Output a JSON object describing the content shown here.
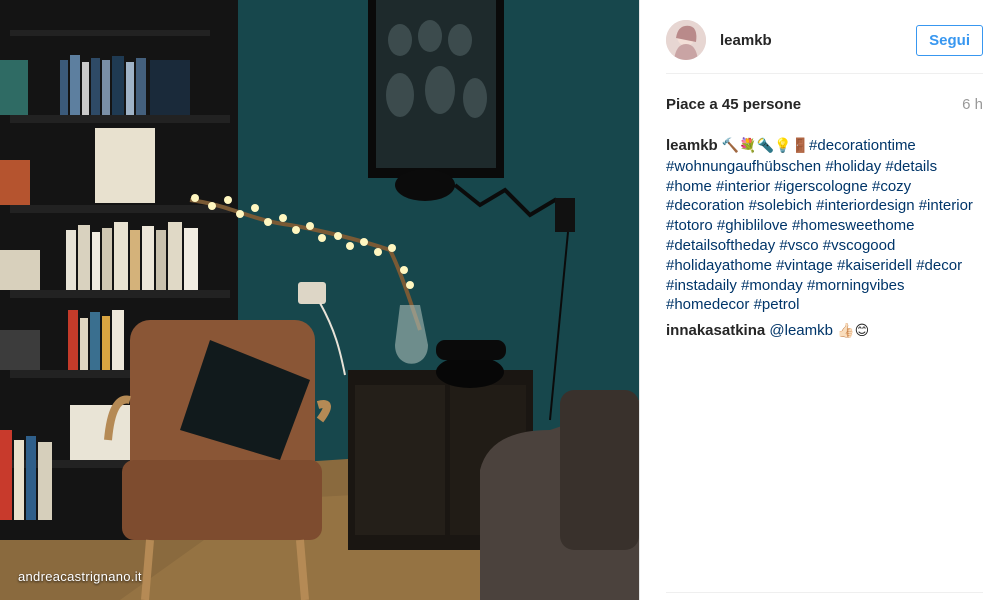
{
  "watermark": "andreacastrignano.it",
  "post": {
    "author": "leamkb",
    "follow_label": "Segui",
    "likes": "Piace a 45 persone",
    "time": "6 h"
  },
  "caption": {
    "user": "leamkb",
    "emojis": "🔨💐🔦💡🚪",
    "tags": [
      "#decorationtime",
      "#wohnungaufhübschen",
      "#holiday",
      "#details",
      "#home",
      "#interior",
      "#igerscologne",
      "#cozy",
      "#decoration",
      "#solebich",
      "#interiordesign",
      "#interior",
      "#totoro",
      "#ghiblilove",
      "#homesweethome",
      "#detailsoftheday",
      "#vsco",
      "#vscogood",
      "#holidayathome",
      "#vintage",
      "#kaiseridell",
      "#decor",
      "#instadaily",
      "#monday",
      "#morningvibes",
      "#homedecor",
      "#petrol"
    ]
  },
  "comment": {
    "user": "innakasatkina",
    "mention": "@leamkb",
    "emojis": "👍🏻😊"
  }
}
